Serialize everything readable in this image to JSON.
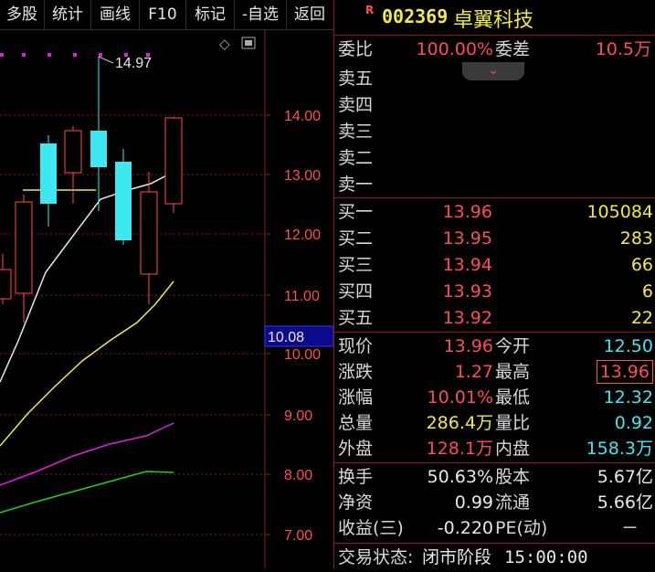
{
  "toolbar": {
    "items": [
      "多股",
      "统计",
      "画线",
      "F10",
      "标记",
      "-自选",
      "返回"
    ]
  },
  "chart": {
    "high_label": "14.97",
    "current_price_label": "10.08",
    "y_ticks": [
      "14.00",
      "13.00",
      "12.00",
      "11.00",
      "10.00",
      "9.00",
      "8.00",
      "7.00"
    ]
  },
  "stock": {
    "flag": "R",
    "code": "002369",
    "name": "卓翼科技"
  },
  "weibi": {
    "label1": "委比",
    "value1": "100.00%",
    "label2": "委差",
    "value2": "10.5万"
  },
  "asks": [
    {
      "label": "卖五",
      "price": "",
      "volume": ""
    },
    {
      "label": "卖四",
      "price": "",
      "volume": ""
    },
    {
      "label": "卖三",
      "price": "",
      "volume": ""
    },
    {
      "label": "卖二",
      "price": "",
      "volume": ""
    },
    {
      "label": "卖一",
      "price": "",
      "volume": ""
    }
  ],
  "bids": [
    {
      "label": "买一",
      "price": "13.96",
      "volume": "105084"
    },
    {
      "label": "买二",
      "price": "13.95",
      "volume": "283"
    },
    {
      "label": "买三",
      "price": "13.94",
      "volume": "66"
    },
    {
      "label": "买四",
      "price": "13.93",
      "volume": "6"
    },
    {
      "label": "买五",
      "price": "13.92",
      "volume": "22"
    }
  ],
  "quote": [
    {
      "l1": "现价",
      "v1": "13.96",
      "l2": "今开",
      "v2": "12.50"
    },
    {
      "l1": "涨跌",
      "v1": "1.27",
      "l2": "最高",
      "v2": "13.96"
    },
    {
      "l1": "涨幅",
      "v1": "10.01%",
      "l2": "最低",
      "v2": "12.32"
    },
    {
      "l1": "总量",
      "v1": "286.4万",
      "l2": "量比",
      "v2": "0.92"
    },
    {
      "l1": "外盘",
      "v1": "128.1万",
      "l2": "内盘",
      "v2": "158.3万"
    }
  ],
  "fundamentals": [
    {
      "l1": "换手",
      "v1": "50.63%",
      "l2": "股本",
      "v2": "5.67亿"
    },
    {
      "l1": "净资",
      "v1": "0.99",
      "l2": "流通",
      "v2": "5.66亿"
    },
    {
      "l1": "收益(三)",
      "v1": "-0.220",
      "l2": "PE(动)",
      "v2": "－"
    }
  ],
  "status": {
    "label": "交易状态:",
    "value": "闭市阶段",
    "time": "15:00:00"
  },
  "colors": {
    "up": "#ff4d4d",
    "down": "#3ee8f0",
    "ma5": "#e8e8e8",
    "ma10": "#f2e84b",
    "ma20": "#e020e0",
    "ma30": "#20d020",
    "grid": "#8b1a1a"
  }
}
